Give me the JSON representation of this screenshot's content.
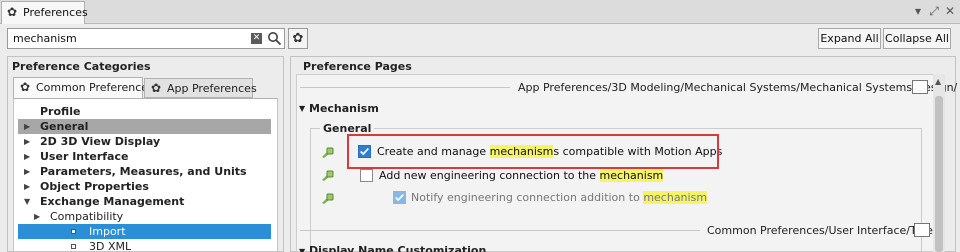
{
  "window": {
    "tab_title": "Preferences",
    "controls": [
      "▾",
      "⤢",
      "✕"
    ]
  },
  "search": {
    "value": "mechanism",
    "clear_glyph": "✕"
  },
  "buttons": {
    "expand_all": "Expand All",
    "collapse_all": "Collapse All"
  },
  "left": {
    "title": "Preference Categories",
    "tabs": {
      "common": "Common Preferences",
      "app": "App Preferences"
    },
    "tree": [
      {
        "label": "Profile",
        "bold": true,
        "arrow": "",
        "indent": 0,
        "state": ""
      },
      {
        "label": "General",
        "bold": true,
        "arrow": "▶",
        "indent": 0,
        "state": "grey"
      },
      {
        "label": "2D 3D View Display",
        "bold": true,
        "arrow": "▶",
        "indent": 0,
        "state": ""
      },
      {
        "label": "User Interface",
        "bold": true,
        "arrow": "▶",
        "indent": 0,
        "state": ""
      },
      {
        "label": "Parameters, Measures, and Units",
        "bold": true,
        "arrow": "▶",
        "indent": 0,
        "state": ""
      },
      {
        "label": "Object Properties",
        "bold": true,
        "arrow": "▶",
        "indent": 0,
        "state": ""
      },
      {
        "label": "Exchange Management",
        "bold": true,
        "arrow": "▼",
        "indent": 0,
        "state": ""
      },
      {
        "label": "Compatibility",
        "bold": false,
        "arrow": "▶",
        "indent": 1,
        "state": ""
      },
      {
        "label": "Import",
        "bold": false,
        "arrow": "",
        "indent": 2,
        "state": "blue"
      },
      {
        "label": "3D XML",
        "bold": false,
        "arrow": "",
        "indent": 2,
        "state": ""
      }
    ]
  },
  "right": {
    "title": "Preference Pages",
    "path_top": "App Preferences/3D Modeling/Mechanical Systems/Mechanical Systems Design/",
    "section": "Mechanism",
    "section_arrow": "▼",
    "group": "General",
    "option1": {
      "pre": "Create and manage ",
      "hl": "mechanism",
      "post": "s compatible with Motion Apps",
      "checked": true
    },
    "option2": {
      "pre": "Add new engineering connection to the ",
      "hl": "mechanism",
      "post": "",
      "checked": false
    },
    "option3": {
      "pre": "Notify engineering connection addition to ",
      "hl": "mechanism",
      "post": "",
      "checked": true
    },
    "path_bottom": "Common Preferences/User Interface/Tree/",
    "next_section": "Display Name Customization",
    "scroll_up": "▲"
  },
  "colors": {
    "highlight": "#f6f36b",
    "selection": "#2b8fd7",
    "annotation_box": "#d73a3a"
  }
}
